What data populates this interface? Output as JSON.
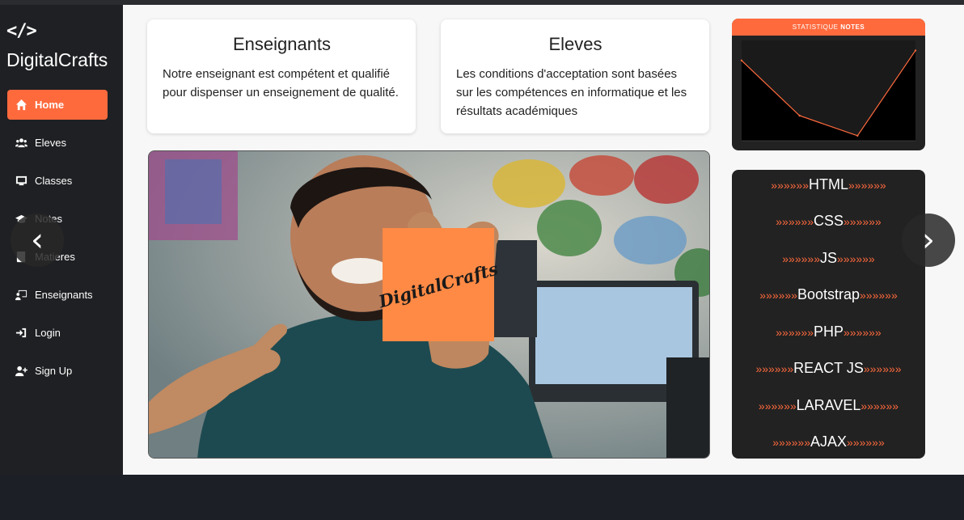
{
  "brand": {
    "icon_text": "</>",
    "name": "DigitalCrafts"
  },
  "sidebar": {
    "items": [
      {
        "label": "Home",
        "icon": "home-icon"
      },
      {
        "label": "Eleves",
        "icon": "users-icon"
      },
      {
        "label": "Classes",
        "icon": "chalkboard-icon"
      },
      {
        "label": "Notes",
        "icon": "graduation-cap-icon"
      },
      {
        "label": "Matieres",
        "icon": "book-icon"
      },
      {
        "label": "Enseignants",
        "icon": "teacher-icon"
      },
      {
        "label": "Login",
        "icon": "sign-in-icon"
      },
      {
        "label": "Sign Up",
        "icon": "user-plus-icon"
      }
    ]
  },
  "cards": {
    "enseignants": {
      "title": "Enseignants",
      "text": "Notre enseignant est compétent et qualifié pour dispenser un enseignement de qualité."
    },
    "eleves": {
      "title": "Eleves",
      "text": "Les conditions d'acceptation sont basées sur les compétences en informatique et les résultats académiques"
    }
  },
  "hero": {
    "sticky_note_text": "DigitalCrafts"
  },
  "stats": {
    "header_prefix": "STATISTIQUE ",
    "header_bold": "NOTES"
  },
  "chart_data": {
    "type": "line",
    "title": "STATISTIQUE NOTES",
    "x": [
      0,
      1,
      2,
      3
    ],
    "values": [
      16,
      5,
      1,
      18
    ],
    "ylim": [
      0,
      20
    ],
    "grid": false,
    "fill": "#000000",
    "line_color": "#ff6a3d"
  },
  "tech": {
    "arrows": "»»»»»»",
    "items": [
      "HTML",
      "CSS",
      "JS",
      "Bootstrap",
      "PHP",
      "REACT JS",
      "LARAVEL",
      "AJAX"
    ]
  },
  "carousel": {
    "prev": "‹",
    "next": "›"
  },
  "colors": {
    "accent": "#ff6a3d",
    "sidebar_bg": "#1f2023",
    "sticky_note": "#ff8a45"
  }
}
